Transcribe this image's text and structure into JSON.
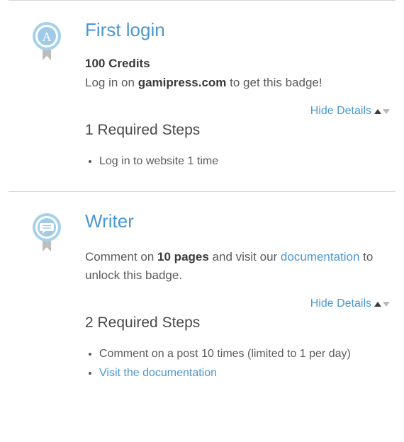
{
  "common": {
    "hide_details": "Hide Details"
  },
  "achievements": [
    {
      "title": "First login",
      "icon_letter": "A",
      "points": "100 Credits",
      "desc_pre": "Log in on ",
      "desc_bold": "gamipress.com",
      "desc_post": " to get this badge!",
      "desc_link": "",
      "desc_tail": "",
      "steps_heading": "1 Required Steps",
      "steps": [
        {
          "text": "Log in to website 1 time"
        }
      ]
    },
    {
      "title": "Writer",
      "icon_letter": "",
      "points": "",
      "desc_pre": "Comment on ",
      "desc_bold": "10 pages",
      "desc_post": " and visit our ",
      "desc_link": "documentation",
      "desc_tail": " to unlock this badge.",
      "steps_heading": "2 Required Steps",
      "steps": [
        {
          "text": "Comment on a post 10 times (limited to 1 per day)"
        },
        {
          "link": "Visit the documentation"
        }
      ]
    }
  ]
}
